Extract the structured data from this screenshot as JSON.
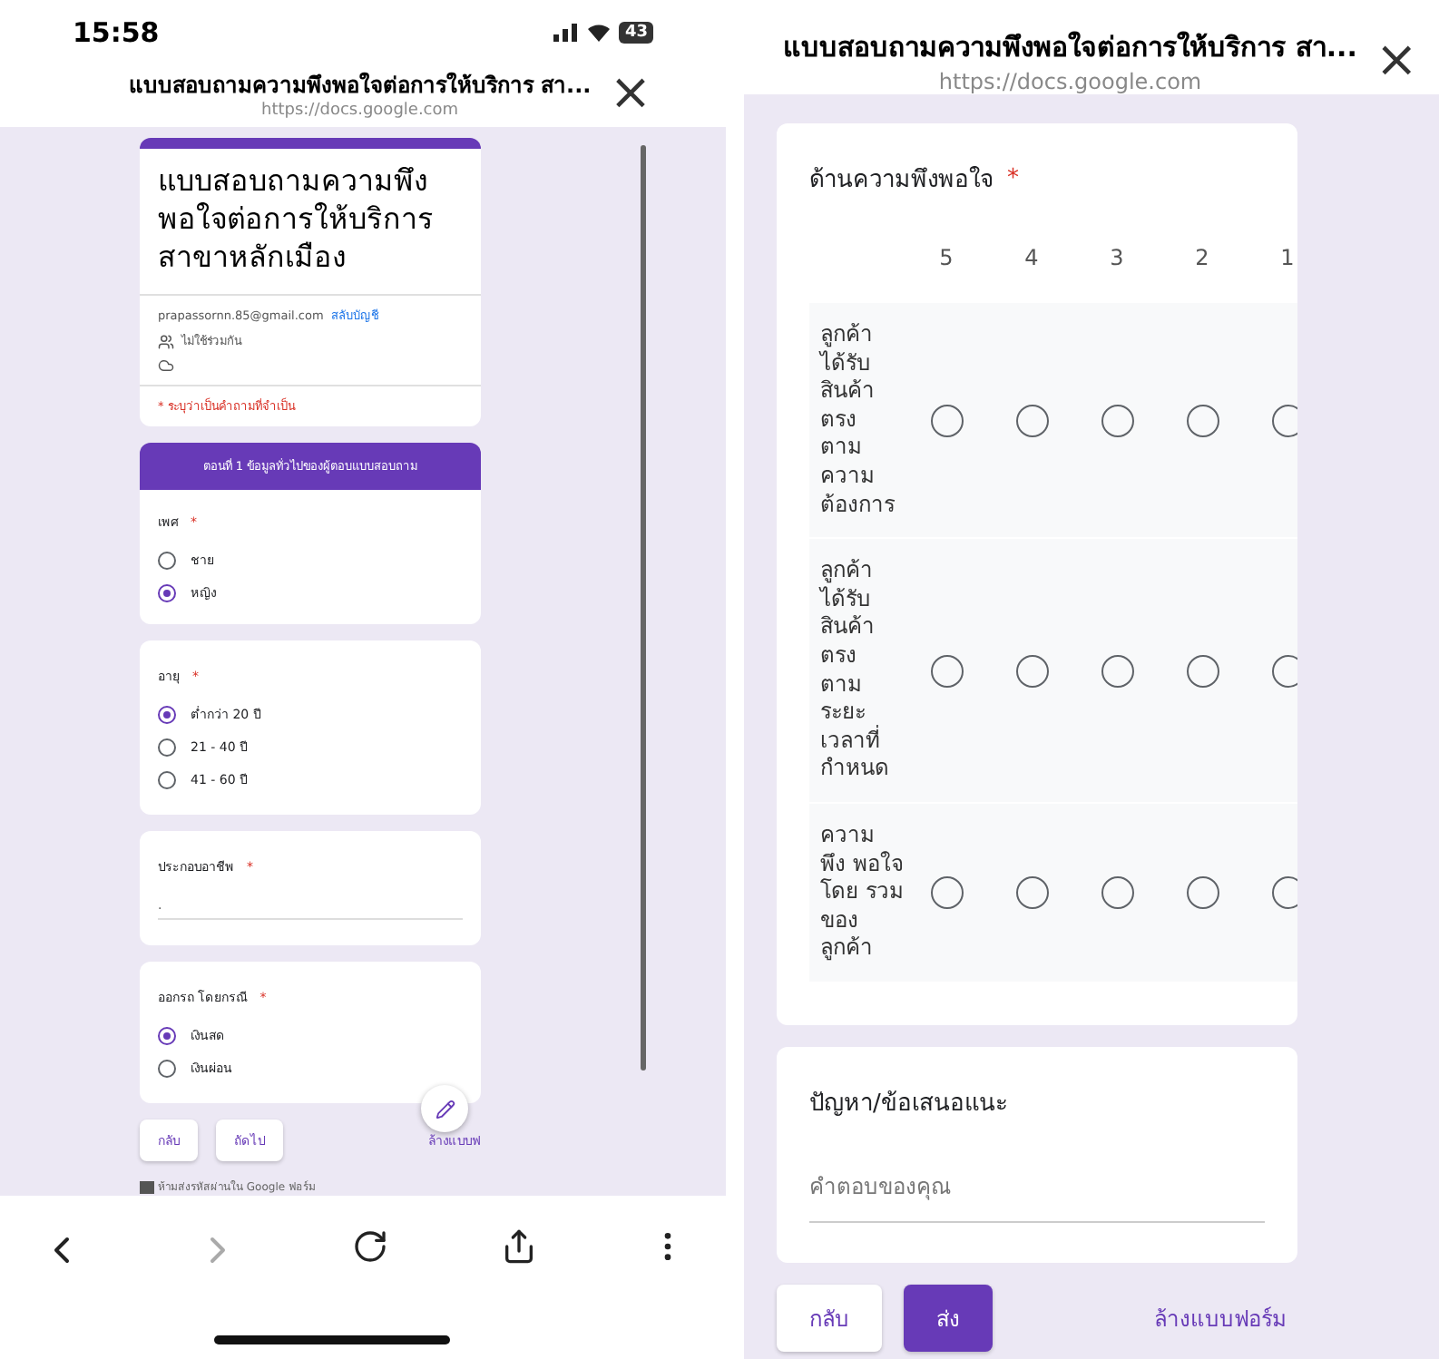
{
  "left_screen": {
    "status_bar": {
      "time": "15:58",
      "battery": "43"
    },
    "header": {
      "title": "แบบสอบถามความพึงพอใจต่อการให้บริการ สา...",
      "url": "https://docs.google.com",
      "close": "×"
    },
    "form_title": "แบบสอบถามความพึงพอใจต่อการให้บริการสาขาหลักเมือง",
    "account": {
      "email": "prapassornn.85@gmail.com",
      "switch_link": "สลับบัญชี",
      "sharing": "ไม่ใช้ร่วมกัน"
    },
    "required_note": "* ระบุว่าเป็นคำถามที่จำเป็น",
    "section_title": "ตอนที่ 1 ข้อมูลทั่วไปของผู้ตอบแบบสอบถาม",
    "questions": [
      {
        "kind": "radio",
        "title": "เพศ",
        "required_mark": "*",
        "options": [
          {
            "label": "ชาย",
            "selected": false
          },
          {
            "label": "หญิง",
            "selected": true
          }
        ]
      },
      {
        "kind": "radio",
        "title": "อายุ",
        "required_mark": "*",
        "options": [
          {
            "label": "ต่ำกว่า 20 ปี",
            "selected": true
          },
          {
            "label": "21 - 40 ปี",
            "selected": false
          },
          {
            "label": "41 - 60 ปี",
            "selected": false
          }
        ]
      },
      {
        "kind": "text",
        "title": "ประกอบอาชีพ",
        "required_mark": "*",
        "value": "."
      },
      {
        "kind": "radio",
        "title": "ออกรถ โดยกรณี",
        "required_mark": "*",
        "options": [
          {
            "label": "เงินสด",
            "selected": true
          },
          {
            "label": "เงินผ่อน",
            "selected": false
          }
        ]
      }
    ],
    "buttons": [
      {
        "label": "กลับ"
      },
      {
        "label": "ถัดไป"
      }
    ],
    "clear_link": "ล้างแบบฟ",
    "footer_note": "ห้ามส่งรหัสผ่านใน Google ฟอร์ม"
  },
  "right_screen": {
    "header": {
      "title": "แบบสอบถามความพึงพอใจต่อการให้บริการ สา...",
      "url": "https://docs.google.com",
      "close": "×"
    },
    "grid_question": {
      "title": "ด้านความพึงพอใจ",
      "required_mark": "*",
      "columns": [
        "5",
        "4",
        "3",
        "2",
        "1"
      ],
      "rows": [
        {
          "label": "ลูกค้า ได้รับ สินค้า ตรง ตาม ความ ต้องการ",
          "selected": [
            false,
            false,
            false,
            false,
            false
          ]
        },
        {
          "label": "ลูกค้า ได้รับ สินค้า ตรง ตาม ระยะ เวลาที่ กำหนด",
          "selected": [
            false,
            false,
            false,
            false,
            false
          ]
        },
        {
          "label": "ความ พึง พอใจ โดย รวมของ ลูกค้า",
          "selected": [
            false,
            false,
            false,
            false,
            false
          ]
        }
      ]
    },
    "text_question": {
      "title": "ปัญหา/ข้อเสนอแนะ",
      "placeholder": "คำตอบของคุณ"
    },
    "buttons": [
      {
        "label": "กลับ",
        "primary": false
      },
      {
        "label": "ส่ง",
        "primary": true
      }
    ],
    "clear_link": "ล้างแบบฟอร์ม"
  }
}
